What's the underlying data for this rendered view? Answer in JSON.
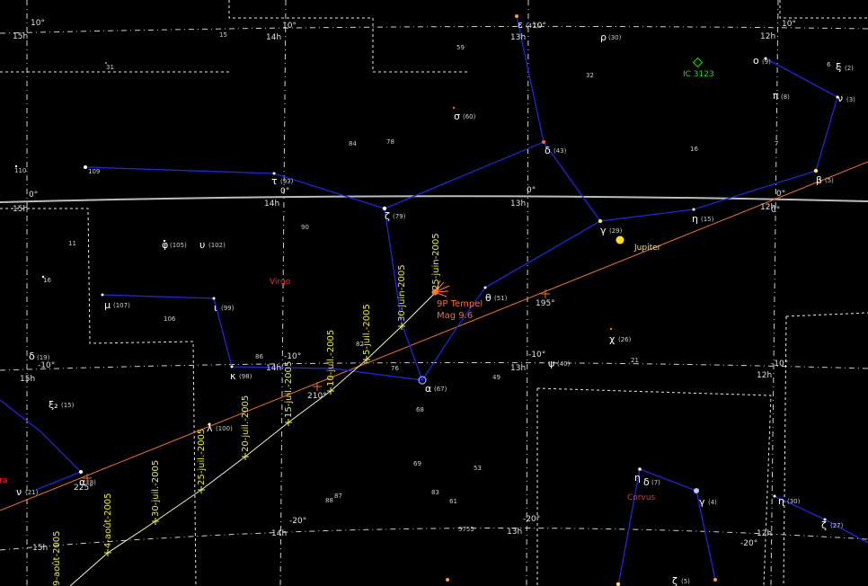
{
  "grid_labels": {
    "ra": [
      "15h",
      "14h",
      "13h",
      "12h"
    ],
    "dec": [
      "10°",
      "0°",
      "-10°",
      "-20°"
    ]
  },
  "ecliptic_label": "195°",
  "ecliptic_label_2": "210°",
  "ecliptic_label_3": "225°",
  "constellations": [
    "Virgo",
    "Corvus",
    "Libra"
  ],
  "comet": {
    "name": "9P Tempel",
    "magnitude": "Mag 9.6"
  },
  "planet": "Jupiter",
  "deep_sky": "IC 3123",
  "track_dates": [
    "25-juin-2005",
    "30-juin-2005",
    "5-juil.-2005",
    "10-juil.-2005",
    "15-juil.-2005",
    "20-juil.-2005",
    "25-juil.-2005",
    "30-juil.-2005",
    "4-août-2005",
    "9-août-2005"
  ],
  "stars": {
    "epsilon": {
      "sym": "ε",
      "num": "(47)"
    },
    "rho": {
      "sym": "ρ",
      "num": "(30)"
    },
    "omicron": {
      "sym": "o",
      "num": "(9)"
    },
    "xi": {
      "sym": "ξ",
      "num": "(2)"
    },
    "nu": {
      "sym": "ν",
      "num": "(3)"
    },
    "pi": {
      "sym": "π",
      "num": "(8)"
    },
    "sigma": {
      "sym": "σ",
      "num": "(60)"
    },
    "delta": {
      "sym": "δ",
      "num": "(43)"
    },
    "tau": {
      "sym": "τ",
      "num": "(93)"
    },
    "zeta": {
      "sym": "ζ",
      "num": "(79)"
    },
    "gamma": {
      "sym": "γ",
      "num": "(29)"
    },
    "eta": {
      "sym": "η",
      "num": "(15)"
    },
    "beta": {
      "sym": "β",
      "num": "(5)"
    },
    "phi": {
      "sym": "φ",
      "num": "(105)"
    },
    "upsilon": {
      "sym": "υ",
      "num": "(102)"
    },
    "mu": {
      "sym": "μ",
      "num": "(107)"
    },
    "iota": {
      "sym": "ι",
      "num": "(99)"
    },
    "theta": {
      "sym": "θ",
      "num": "(51)"
    },
    "chi": {
      "sym": "χ",
      "num": "(26)"
    },
    "psi": {
      "sym": "ψ",
      "num": "(40)"
    },
    "kappa": {
      "sym": "κ",
      "num": "(98)"
    },
    "alpha": {
      "sym": "α",
      "num": "(67)"
    },
    "delta19": {
      "sym": "δ",
      "num": "(19)"
    },
    "xi2": {
      "sym": "ξ₂",
      "num": "(15)"
    },
    "lambda": {
      "sym": "λ",
      "num": "(100)"
    },
    "nu21": {
      "sym": "ν",
      "num": "(21)"
    },
    "alpha_lib": {
      "sym": "α",
      "num": "(8)"
    },
    "eta_crv": {
      "sym": "η",
      "num": ""
    },
    "delta_crv": {
      "sym": "δ",
      "num": "(7)"
    },
    "gamma_crv": {
      "sym": "γ",
      "num": "(4)"
    },
    "eta30": {
      "sym": "η",
      "num": "(30)"
    },
    "zeta27": {
      "sym": "ζ",
      "num": "(27)"
    },
    "zeta5": {
      "sym": "ζ",
      "num": "(5)"
    }
  },
  "flamsteed": [
    "31",
    "15",
    "59",
    "32",
    "84",
    "78",
    "16",
    "110",
    "109",
    "90",
    "11",
    "16",
    "106",
    "82",
    "86",
    "76",
    "49",
    "21",
    "68",
    "69",
    "53",
    "83",
    "61",
    "88",
    "87",
    "5755",
    "6",
    "2",
    "7"
  ]
}
